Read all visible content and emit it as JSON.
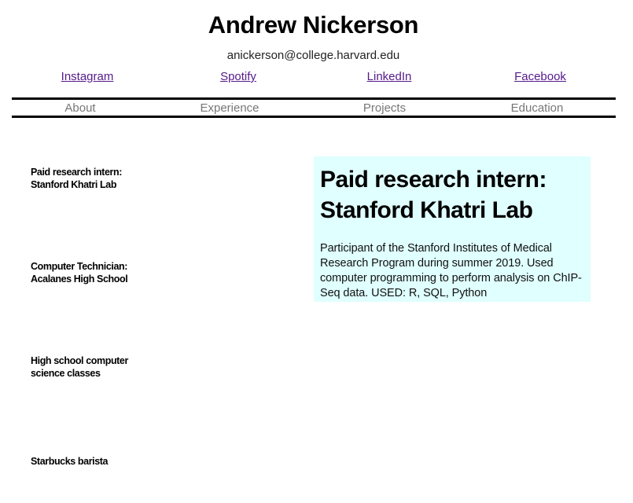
{
  "header": {
    "name": "Andrew Nickerson",
    "email": "anickerson@college.harvard.edu"
  },
  "social_links": [
    {
      "label": "Instagram",
      "icon": "instagram"
    },
    {
      "label": "Spotify",
      "icon": "spotify"
    },
    {
      "label": "LinkedIn",
      "icon": "linkedin"
    },
    {
      "label": "Facebook",
      "icon": "facebook"
    }
  ],
  "nav": {
    "items": [
      {
        "label": "About"
      },
      {
        "label": "Experience"
      },
      {
        "label": "Projects"
      },
      {
        "label": "Education"
      }
    ]
  },
  "experience": {
    "items": [
      {
        "title": "Paid research intern: Stanford Khatri Lab"
      },
      {
        "title": "Computer Technician: Acalanes High School"
      },
      {
        "title": "High school computer science classes"
      },
      {
        "title": "Starbucks barista"
      }
    ],
    "selected": {
      "title": "Paid research intern: Stanford Khatri Lab",
      "description": "Participant of the Stanford Institutes of Medical Research Program during summer 2019. Used computer programming to perform analysis on ChIP-Seq data. USED: R, SQL, Python"
    }
  },
  "colors": {
    "link": "#551a8b",
    "nav_text": "#777777",
    "detail_bg": "#e0ffff"
  }
}
